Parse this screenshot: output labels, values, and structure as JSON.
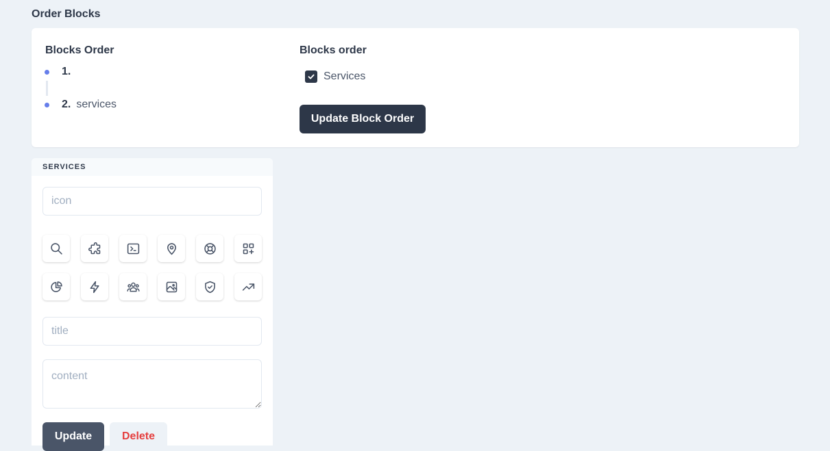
{
  "page": {
    "heading": "Order Blocks"
  },
  "order_card": {
    "left_title": "Blocks Order",
    "items": [
      {
        "num": "1.",
        "label": ""
      },
      {
        "num": "2.",
        "label": "services"
      }
    ],
    "right_title": "Blocks order",
    "checkbox_label": "Services",
    "checkbox_checked": true,
    "update_button": "Update Block Order"
  },
  "services": {
    "header": "SERVICES",
    "icon_placeholder": "icon",
    "title_placeholder": "title",
    "content_placeholder": "content",
    "icons": [
      "search-icon",
      "puzzle-icon",
      "terminal-icon",
      "location-pin-icon",
      "lifebuoy-icon",
      "view-grid-add-icon",
      "chart-pie-icon",
      "lightning-bolt-icon",
      "user-group-icon",
      "photograph-icon",
      "shield-check-icon",
      "trending-up-icon"
    ],
    "update_button": "Update",
    "delete_button": "Delete"
  },
  "colors": {
    "background": "#edf2f7",
    "primary_dark": "#2d3748",
    "accent_dot": "#667eea",
    "delete_red": "#e53e3e"
  }
}
